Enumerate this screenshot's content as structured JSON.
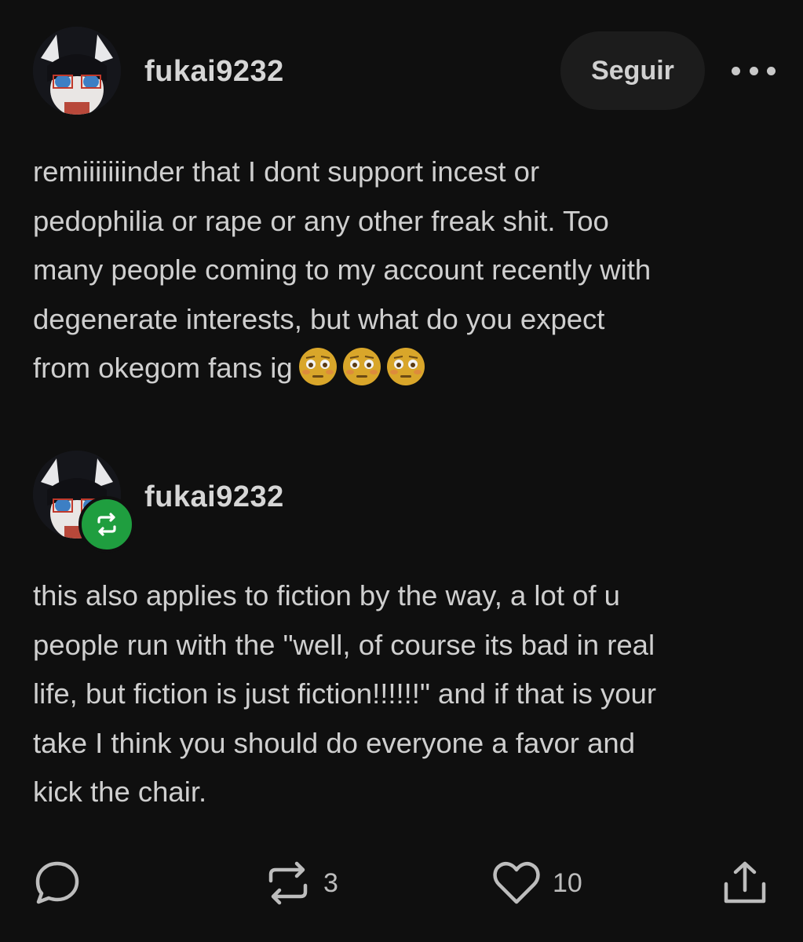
{
  "post": {
    "username": "fukai9232",
    "follow_label": "Seguir",
    "more_icon": "more-horizontal-icon",
    "body": "remiiiiiiinder that I dont support incest or\npedophilia or rape or any other freak shit. Too\nmany people coming to my account recently with\ndegenerate interests, but what do you expect\nfrom okegom fans ig",
    "emojis": [
      "😳",
      "😳",
      "😳"
    ]
  },
  "reblog": {
    "username": "fukai9232",
    "badge_icon": "reblog-icon",
    "badge_color": "#1f9e3f",
    "body": "this also applies to fiction by the way, a lot of u\npeople run with the \"well, of course its bad in real\nlife, but fiction is just fiction!!!!!!\" and if that is your\ntake I think you should do everyone a favor and\nkick the chair."
  },
  "actions": {
    "comment_icon": "comment-icon",
    "reblog_icon": "reblog-icon",
    "reblog_count": "3",
    "like_icon": "heart-icon",
    "like_count": "10",
    "share_icon": "share-icon"
  }
}
